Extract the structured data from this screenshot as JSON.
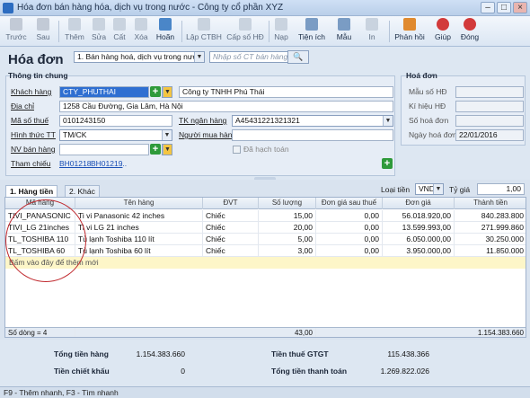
{
  "window": {
    "title": "Hóa đơn bán hàng hóa, dịch vụ trong nước - Công ty cổ phần XYZ"
  },
  "toolbar": {
    "buttons": [
      "Trước",
      "Sau",
      "Thêm",
      "Sửa",
      "Cất",
      "Xóa",
      "Hoãn",
      "Lập CTBH",
      "Cấp số HĐ",
      "Nạp",
      "Tiện ích",
      "Mẫu",
      "In",
      "Phản hồi",
      "Giúp",
      "Đóng"
    ]
  },
  "form": {
    "heading": "Hóa đơn",
    "type_select": "1. Bán hàng hoá, dịch vụ trong nước",
    "search_placeholder": "Nhập số CT bán hàng",
    "general_title": "Thông tin chung",
    "customer_label": "Khách hàng",
    "customer_code": "CTY_PHUTHAI",
    "customer_name": "Công ty TNHH Phú Thái",
    "address_label": "Địa chỉ",
    "address": "1258 Cầu Đường, Gia Lâm, Hà Nội",
    "tax_label": "Mã số thuế",
    "tax_code": "0101243150",
    "bank_label": "TK ngân hàng",
    "bank_account": "A45431221321321",
    "payment_label": "Hình thức TT",
    "payment": "TM/CK",
    "buyer_label": "Người mua hàng",
    "buyer": "",
    "seller_label": "NV bán hàng",
    "seller": "",
    "accounted_label": "Đã hạch toán",
    "reference_label": "Tham chiếu",
    "references": [
      "BH01218",
      "BH01219",
      "..."
    ],
    "invoice_title": "Hoá đơn",
    "form_no_label": "Mẫu số HĐ",
    "symbol_label": "Kí hiệu HĐ",
    "invoice_no_label": "Số hoá đơn",
    "invoice_date_label": "Ngày hoá đơn",
    "invoice_date": "22/01/2016"
  },
  "tabs": [
    "1. Hàng tiền",
    "2. Khác"
  ],
  "currency": {
    "label": "Loại tiền",
    "value": "VND",
    "rate_label": "Tỷ giá",
    "rate": "1,00"
  },
  "grid": {
    "columns": [
      "Mã hàng",
      "Tên hàng",
      "ĐVT",
      "Số lượng",
      "Đơn giá sau thuế",
      "Đơn giá",
      "Thành tiền"
    ],
    "rows": [
      [
        "TIVI_PANASONIC",
        "Ti vi Panasonic 42 inches",
        "Chiếc",
        "15,00",
        "0,00",
        "56.018.920,00",
        "840.283.800"
      ],
      [
        "TIVI_LG 21inches",
        "Ti vi LG 21 inches",
        "Chiếc",
        "20,00",
        "0,00",
        "13.599.993,00",
        "271.999.860"
      ],
      [
        "TL_TOSHIBA 110",
        "Tủ lạnh Toshiba 110 lít",
        "Chiếc",
        "5,00",
        "0,00",
        "6.050.000,00",
        "30.250.000"
      ],
      [
        "TL_TOSHIBA 60",
        "Tủ lạnh Toshiba 60 lít",
        "Chiếc",
        "3,00",
        "0,00",
        "3.950.000,00",
        "11.850.000"
      ]
    ],
    "new_row_hint": "Bấm vào đây để thêm mới",
    "footer_count": "Số dòng = 4",
    "footer_qty": "43,00",
    "footer_total": "1.154.383.660"
  },
  "summary": {
    "total_goods_label": "Tổng tiền hàng",
    "total_goods": "1.154.383.660",
    "discount_label": "Tiền chiết khấu",
    "discount": "0",
    "vat_label": "Tiền thuế GTGT",
    "vat": "115.438.366",
    "payment_total_label": "Tổng tiền thanh toán",
    "payment_total": "1.269.822.026"
  },
  "status": "F9 - Thêm nhanh, F3 - Tìm nhanh",
  "colors": {
    "highlight": "#2f6fd1",
    "annotation": "#c0282d",
    "new_row": "#fdf6c8"
  }
}
